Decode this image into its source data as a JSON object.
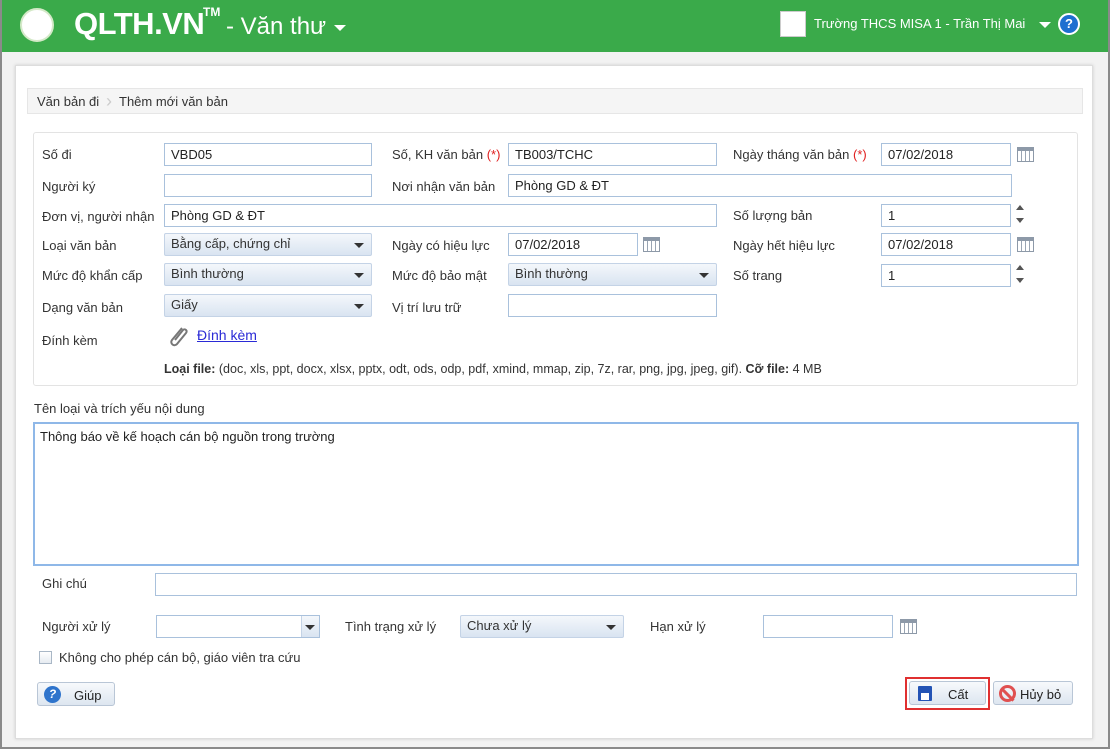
{
  "header": {
    "brand": "QLTH.VN",
    "tm": "TM",
    "module": "- Văn thư",
    "user": "Trường THCS MISA 1 - Trần Thị Mai",
    "help": "?"
  },
  "breadcrumb": [
    "Văn bản đi",
    "Thêm mới văn bản"
  ],
  "form": {
    "so_di": {
      "label": "Số đi",
      "value": "VBD05"
    },
    "so_kh": {
      "label": "Số, KH văn bản",
      "req": "(*)",
      "value": "TB003/TCHC"
    },
    "ngay_vb": {
      "label": "Ngày tháng văn bản",
      "req": "(*)",
      "value": "07/02/2018"
    },
    "nguoi_ky": {
      "label": "Người ký",
      "value": ""
    },
    "noi_nhan": {
      "label": "Nơi nhận văn bản",
      "value": "Phòng GD & ĐT"
    },
    "don_vi": {
      "label": "Đơn vị, người nhận",
      "value": "Phòng GD & ĐT"
    },
    "so_luong": {
      "label": "Số lượng bản",
      "value": "1"
    },
    "loai_vb": {
      "label": "Loại văn bản",
      "value": "Bằng cấp, chứng chỉ"
    },
    "ngay_hieu_luc": {
      "label": "Ngày có hiệu lực",
      "value": "07/02/2018"
    },
    "ngay_het": {
      "label": "Ngày hết hiệu lực",
      "value": "07/02/2018"
    },
    "khan_cap": {
      "label": "Mức độ khẩn cấp",
      "value": "Bình thường"
    },
    "bao_mat": {
      "label": "Mức độ bảo mật",
      "value": "Bình thường"
    },
    "so_trang": {
      "label": "Số trang",
      "value": "1"
    },
    "dang_vb": {
      "label": "Dạng văn bản",
      "value": "Giấy"
    },
    "vi_tri": {
      "label": "Vị trí lưu trữ",
      "value": ""
    },
    "dinh_kem": {
      "label": "Đính kèm",
      "link": "Đính kèm"
    },
    "file_info": {
      "type_label": "Loại file:",
      "types": " (doc, xls, ppt, docx, xlsx, pptx, odt, ods, odp, pdf, xmind, mmap, zip, 7z, rar, png, jpg, jpeg, gif). ",
      "size_label": "Cỡ file:",
      "size": " 4 MB"
    }
  },
  "trich_yeu": {
    "label": "Tên loại và trích yếu nội dung",
    "value": "Thông báo về kế hoạch cán bộ nguồn trong trường"
  },
  "ghi_chu": {
    "label": "Ghi chú",
    "value": ""
  },
  "nguoi_xu_ly": {
    "label": "Người xử lý",
    "value": ""
  },
  "tinh_trang": {
    "label": "Tình trạng xử lý",
    "value": "Chưa xử lý"
  },
  "han_xu_ly": {
    "label": "Hạn xử lý",
    "value": ""
  },
  "khong_cho_phep": {
    "label": "Không cho phép cán bộ, giáo viên tra cứu",
    "checked": false
  },
  "buttons": {
    "help": "Giúp",
    "save": "Cất",
    "cancel": "Hủy bỏ"
  }
}
